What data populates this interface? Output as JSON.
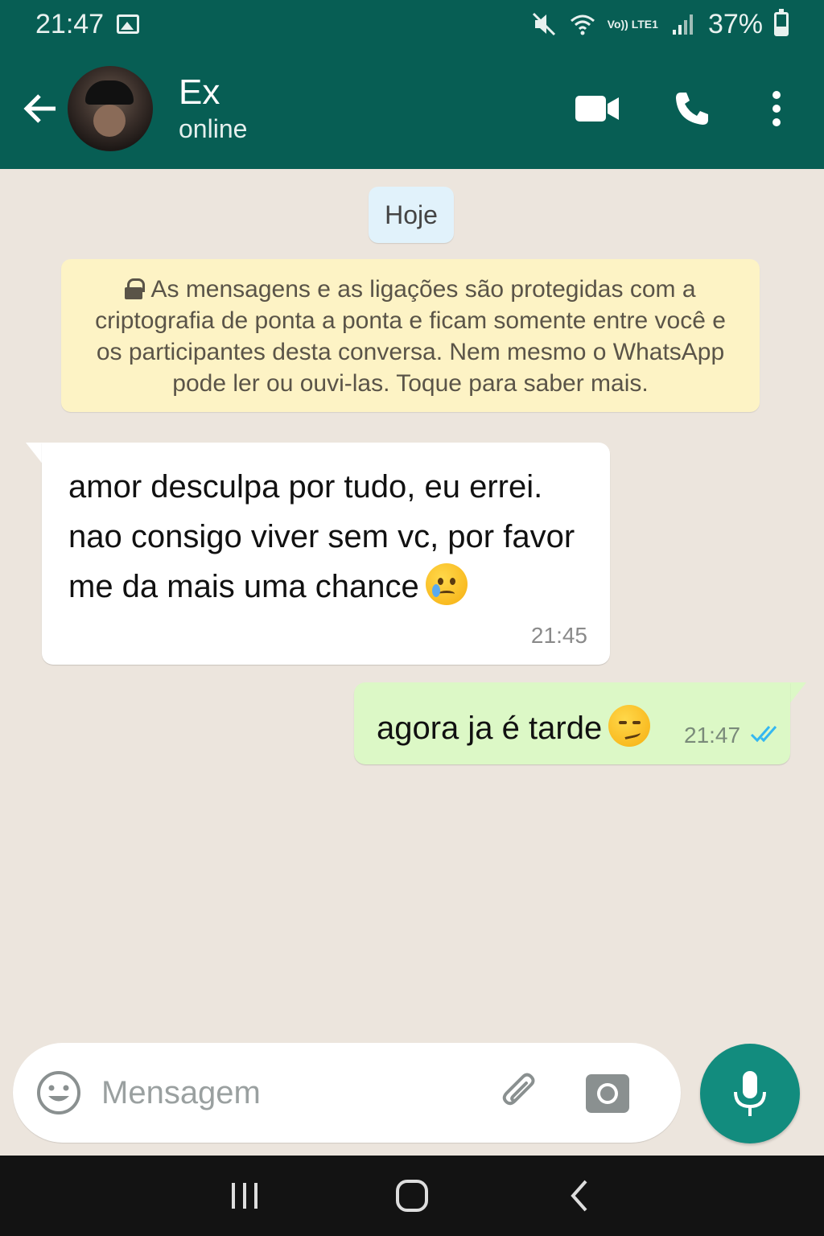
{
  "status_bar": {
    "time": "21:47",
    "battery": "37%",
    "battery_level": 0.37,
    "network": "Vo)) LTE1",
    "icons": [
      "gallery-icon",
      "mute-icon",
      "wifi-icon",
      "signal-icon",
      "battery-icon"
    ]
  },
  "header": {
    "contact_name": "Ex",
    "contact_status": "online",
    "accent_color": "#075e54",
    "icons": [
      "back-arrow-icon",
      "video-call-icon",
      "phone-icon",
      "more-vertical-icon"
    ]
  },
  "chat": {
    "date_label": "Hoje",
    "encryption_notice": "As mensagens e as ligações são protegidas com a criptografia de ponta a ponta e ficam somente entre você e os participantes desta conversa. Nem mesmo o WhatsApp pode ler ou ouvi-las. Toque para saber mais.",
    "messages": [
      {
        "direction": "incoming",
        "text": "amor desculpa por tudo, eu errei. nao consigo viver sem vc, por favor me da mais uma chance",
        "emoji": "crying-face",
        "time": "21:45"
      },
      {
        "direction": "outgoing",
        "text": "agora ja é tarde",
        "emoji": "smirking-face",
        "time": "21:47",
        "status": "read",
        "read_tick_color": "#34b7f1"
      }
    ]
  },
  "input_bar": {
    "placeholder": "Mensagem",
    "icons": [
      "emoji-icon",
      "attach-icon",
      "camera-icon",
      "mic-icon"
    ],
    "mic_color": "#128c7e"
  },
  "nav_bar": {
    "icons": [
      "recent-apps-icon",
      "home-icon",
      "back-icon"
    ]
  }
}
